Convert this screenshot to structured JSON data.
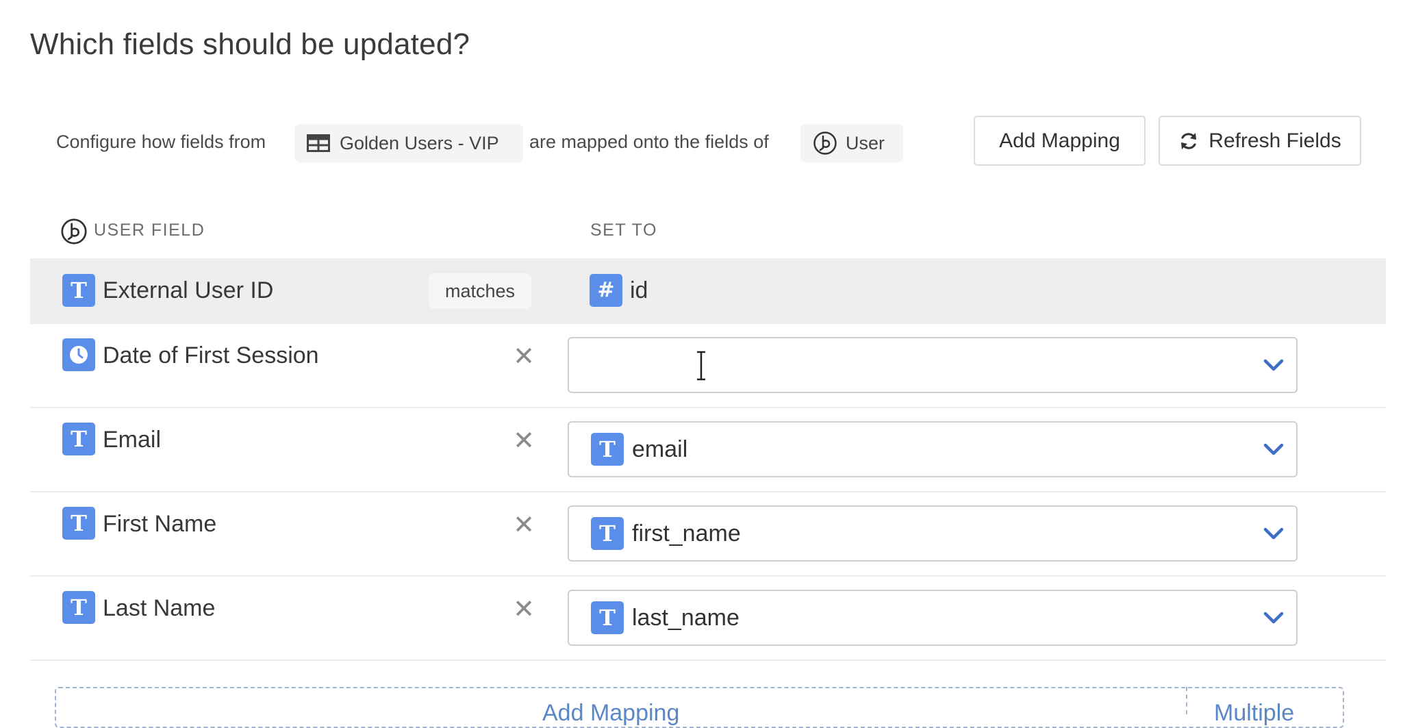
{
  "title": "Which fields should be updated?",
  "config": {
    "prefix": "Configure how fields from",
    "source_name": "Golden Users - VIP",
    "middle": "are mapped onto the fields of",
    "target_name": "User"
  },
  "buttons": {
    "add_mapping": "Add Mapping",
    "refresh_fields": "Refresh Fields"
  },
  "columns": {
    "user_field": "USER FIELD",
    "set_to": "SET TO"
  },
  "key_row": {
    "field": "External User ID",
    "field_type_glyph": "T",
    "operator": "matches",
    "value": "id",
    "value_type_glyph": "#"
  },
  "mappings": [
    {
      "field": "Date of First Session",
      "field_type_glyph": "clock",
      "value": "",
      "value_type_glyph": ""
    },
    {
      "field": "Email",
      "field_type_glyph": "T",
      "value": "email",
      "value_type_glyph": "T"
    },
    {
      "field": "First Name",
      "field_type_glyph": "T",
      "value": "first_name",
      "value_type_glyph": "T"
    },
    {
      "field": "Last Name",
      "field_type_glyph": "T",
      "value": "last_name",
      "value_type_glyph": "T"
    }
  ],
  "remove_glyph": "✕",
  "bottom": {
    "add_mapping": "Add Mapping",
    "multiple": "Multiple"
  },
  "colors": {
    "type_icon_bg": "#5b8ee8",
    "chevron": "#3d6fc7",
    "highlight_row": "#eeeeee"
  }
}
